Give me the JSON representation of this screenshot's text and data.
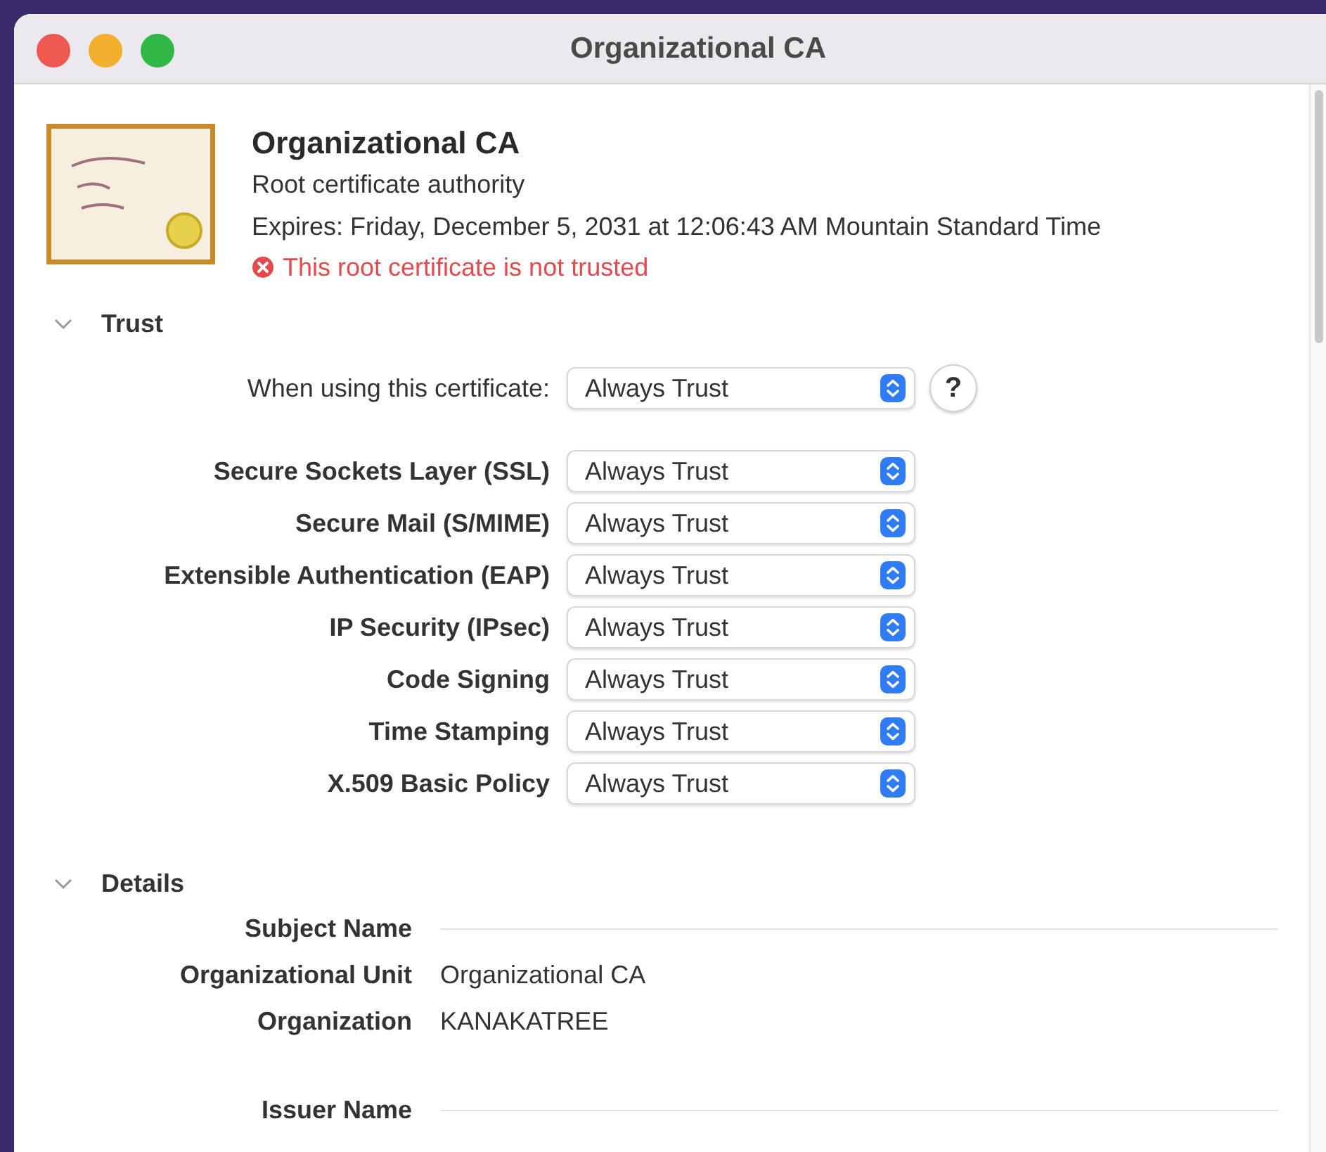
{
  "window": {
    "title": "Organizational CA"
  },
  "certificate": {
    "name": "Organizational CA",
    "type": "Root certificate authority",
    "expires": "Expires: Friday, December 5, 2031 at 12:06:43 AM Mountain Standard Time",
    "warning": "This root certificate is not trusted"
  },
  "trust": {
    "title": "Trust",
    "expanded": true,
    "main_setting": {
      "label": "When using this certificate:",
      "value": "Always Trust"
    },
    "help": "?",
    "policies": [
      {
        "label": "Secure Sockets Layer (SSL)",
        "value": "Always Trust"
      },
      {
        "label": "Secure Mail (S/MIME)",
        "value": "Always Trust"
      },
      {
        "label": "Extensible Authentication (EAP)",
        "value": "Always Trust"
      },
      {
        "label": "IP Security (IPsec)",
        "value": "Always Trust"
      },
      {
        "label": "Code Signing",
        "value": "Always Trust"
      },
      {
        "label": "Time Stamping",
        "value": "Always Trust"
      },
      {
        "label": "X.509 Basic Policy",
        "value": "Always Trust"
      }
    ]
  },
  "details": {
    "title": "Details",
    "expanded": true,
    "groups": [
      {
        "title": "Subject Name",
        "fields": [
          {
            "label": "Organizational Unit",
            "value": "Organizational CA"
          },
          {
            "label": "Organization",
            "value": "KANAKATREE"
          }
        ]
      },
      {
        "title": "Issuer Name"
      }
    ]
  }
}
